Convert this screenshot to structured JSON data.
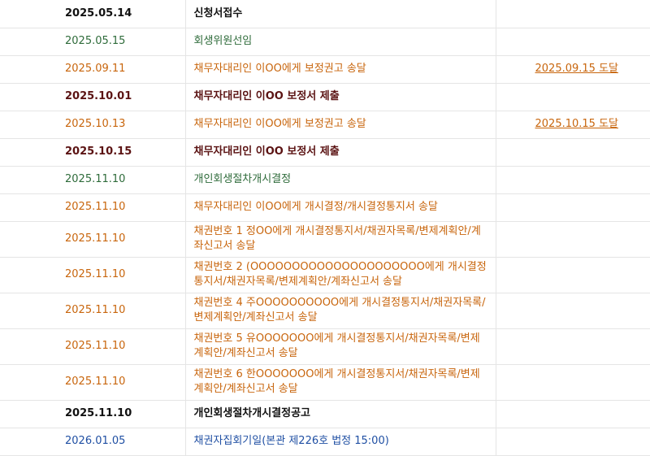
{
  "rows": [
    {
      "date": "2025.05.14",
      "content": "신청서접수",
      "result": "",
      "color": "black"
    },
    {
      "date": "2025.05.15",
      "content": "회생위원선임",
      "result": "",
      "color": "green"
    },
    {
      "date": "2025.09.11",
      "content": "채무자대리인 이OO에게 보정권고 송달",
      "result": "2025.09.15 도달",
      "color": "orange"
    },
    {
      "date": "2025.10.01",
      "content": "채무자대리인 이OO 보정서 제출",
      "result": "",
      "color": "maroon"
    },
    {
      "date": "2025.10.13",
      "content": "채무자대리인 이OO에게 보정권고 송달",
      "result": "2025.10.15 도달",
      "color": "orange"
    },
    {
      "date": "2025.10.15",
      "content": "채무자대리인 이OO 보정서 제출",
      "result": "",
      "color": "maroon"
    },
    {
      "date": "2025.11.10",
      "content": "개인회생절차개시결정",
      "result": "",
      "color": "green"
    },
    {
      "date": "2025.11.10",
      "content": "채무자대리인 이OO에게 개시결정/개시결정통지서 송달",
      "result": "",
      "color": "orange"
    },
    {
      "date": "2025.11.10",
      "content": "채권번호 1 정OO에게 개시결정통지서/채권자목록/변제계획안/계좌신고서 송달",
      "result": "",
      "color": "orange"
    },
    {
      "date": "2025.11.10",
      "content": "채권번호 2 (OOOOOOOOOOOOOOOOOOOOO에게 개시결정통지서/채권자목록/변제계획안/계좌신고서 송달",
      "result": "",
      "color": "orange"
    },
    {
      "date": "2025.11.10",
      "content": "채권번호 4 주OOOOOOOOOO에게 개시결정통지서/채권자목록/변제계획안/계좌신고서 송달",
      "result": "",
      "color": "orange"
    },
    {
      "date": "2025.11.10",
      "content": "채권번호 5 유OOOOOOO에게 개시결정통지서/채권자목록/변제계획안/계좌신고서 송달",
      "result": "",
      "color": "orange"
    },
    {
      "date": "2025.11.10",
      "content": "채권번호 6 한OOOOOOO에게 개시결정통지서/채권자목록/변제계획안/계좌신고서 송달",
      "result": "",
      "color": "orange"
    },
    {
      "date": "2025.11.10",
      "content": "개인회생절차개시결정공고",
      "result": "",
      "color": "black"
    },
    {
      "date": "2026.01.05",
      "content": "채권자집회기일(본관 제226호 법정 15:00)",
      "result": "",
      "color": "blue"
    }
  ]
}
